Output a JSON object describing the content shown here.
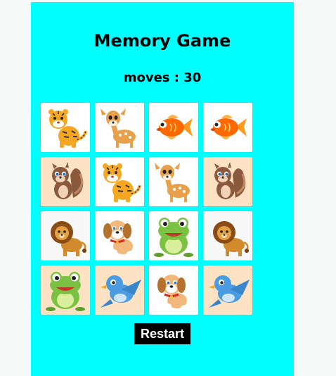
{
  "title": "Memory Game",
  "moves_label": "moves : 30",
  "restart_label": "Restart",
  "colors": {
    "panel": "#00ffff",
    "button_bg": "#000000",
    "button_text": "#ffffff"
  },
  "cards": [
    {
      "animal": "tiger",
      "icon": "tiger-icon",
      "bg": "#ffffff"
    },
    {
      "animal": "deer",
      "icon": "deer-icon",
      "bg": "#ffffff"
    },
    {
      "animal": "goldfish",
      "icon": "goldfish-icon",
      "bg": "#ffffff"
    },
    {
      "animal": "goldfish",
      "icon": "goldfish-icon",
      "bg": "#ffffff"
    },
    {
      "animal": "squirrel",
      "icon": "squirrel-icon",
      "bg": "#fde3c4"
    },
    {
      "animal": "tiger",
      "icon": "tiger-icon",
      "bg": "#ffffff"
    },
    {
      "animal": "deer",
      "icon": "deer-icon",
      "bg": "#ffffff"
    },
    {
      "animal": "squirrel",
      "icon": "squirrel-icon",
      "bg": "#fde3c4"
    },
    {
      "animal": "lion",
      "icon": "lion-icon",
      "bg": "#f7f7f7"
    },
    {
      "animal": "puppy",
      "icon": "puppy-icon",
      "bg": "#ffffff"
    },
    {
      "animal": "frog",
      "icon": "frog-icon",
      "bg": "#ffffff"
    },
    {
      "animal": "lion",
      "icon": "lion-icon",
      "bg": "#f7f7f7"
    },
    {
      "animal": "frog",
      "icon": "frog-icon",
      "bg": "#fde3c4"
    },
    {
      "animal": "bird",
      "icon": "bird-icon",
      "bg": "#fde3c4"
    },
    {
      "animal": "puppy",
      "icon": "puppy-icon",
      "bg": "#ffffff"
    },
    {
      "animal": "bird",
      "icon": "bird-icon",
      "bg": "#fde3c4"
    }
  ]
}
